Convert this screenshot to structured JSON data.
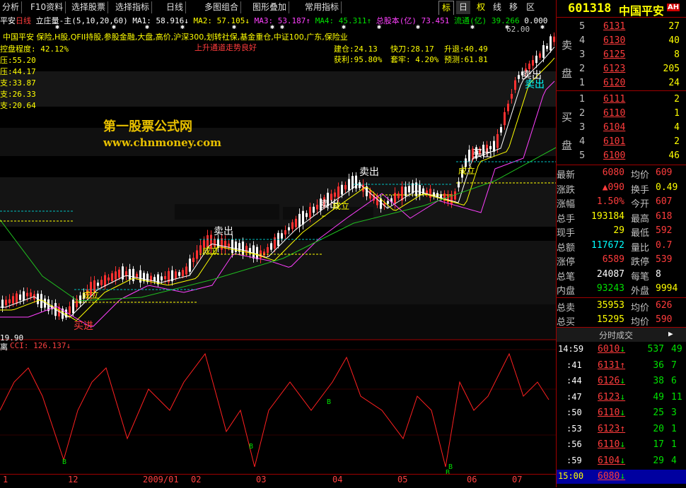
{
  "toolbar": {
    "items": [
      "分析",
      "F10资料",
      "选择股票",
      "选择指标",
      "日线",
      "多图组合",
      "图形叠加",
      "常用指标"
    ],
    "right_buttons": [
      "标",
      "日",
      "权",
      "线",
      "移",
      "区"
    ]
  },
  "stock_header": {
    "code": "601318",
    "name": "中国平安",
    "badge": "AH"
  },
  "chart_info": {
    "stock_short": "平安",
    "period": "日线",
    "formula": "立庄量-主",
    "params": "(5,10,20,60)",
    "ma1": "MA1: 58.916↓",
    "ma2": "MA2: 57.105↓",
    "ma3": "MA3: 53.187↑",
    "ma4": "MA4: 45.311↑",
    "total_cap": "总股本(亿) 73.451",
    "float_cap": "流通(亿) 39.266",
    "extra": "0.000",
    "concepts": "中国平安 保险,H股,QFII持股,参股金融,大盘,高价,沪深300,划转社保,基金重仓,中证100,广东,保险业",
    "trend_text": "上升通道走势良好",
    "control_degree": "控盘程度: 42.12%",
    "level1": "压:55.20",
    "level2": "压:44.17",
    "level3": "支:33.87",
    "level4": "支:26.33",
    "level5": "支:20.64",
    "jiancang": "建仓:24.13",
    "kuaidao": "快刀:28.17",
    "shengtui": "升退:40.49",
    "huoli": "获利:95.80%",
    "taolao": "套牢: 4.20%",
    "yuce": "预测:61.81",
    "top_price": "62.00",
    "low_label": "19.90",
    "watermark1": "第一股票公式网",
    "watermark2": "www.chnmoney.com",
    "signals": [
      "买进",
      "成立",
      "成立",
      "卖出",
      "卖出",
      "成立",
      "卖出",
      "成立",
      "买出",
      "卖出",
      "卖出"
    ]
  },
  "cci": {
    "label": "CCI: 126.137↓",
    "prefix": "离",
    "buy_marks": [
      "B",
      "B",
      "B",
      "B",
      "B"
    ]
  },
  "date_axis": [
    "1",
    "12",
    "2009/01",
    "02",
    "03",
    "04",
    "05",
    "06",
    "07"
  ],
  "quote": {
    "sell_label": "卖盘",
    "buy_label": "买盘",
    "asks": [
      {
        "lvl": "5",
        "price": "6131",
        "vol": "27"
      },
      {
        "lvl": "4",
        "price": "6130",
        "vol": "40"
      },
      {
        "lvl": "3",
        "price": "6125",
        "vol": "8"
      },
      {
        "lvl": "2",
        "price": "6123",
        "vol": "205"
      },
      {
        "lvl": "1",
        "price": "6120",
        "vol": "24"
      }
    ],
    "bids": [
      {
        "lvl": "1",
        "price": "6111",
        "vol": "2"
      },
      {
        "lvl": "2",
        "price": "6110",
        "vol": "1"
      },
      {
        "lvl": "3",
        "price": "6104",
        "vol": "4"
      },
      {
        "lvl": "4",
        "price": "6101",
        "vol": "2"
      },
      {
        "lvl": "5",
        "price": "6100",
        "vol": "46"
      }
    ],
    "stats": [
      {
        "k1": "最新",
        "v1": "6080",
        "k2": "均价",
        "v2": "609"
      },
      {
        "k1": "涨跌",
        "v1": "▲090",
        "k2": "换手",
        "v2": "0.49"
      },
      {
        "k1": "涨幅",
        "v1": "1.50%",
        "k2": "今开",
        "v2": "607"
      },
      {
        "k1": "总手",
        "v1": "193184",
        "k2": "最高",
        "v2": "618"
      },
      {
        "k1": "现手",
        "v1": "29",
        "k2": "最低",
        "v2": "592"
      },
      {
        "k1": "总额",
        "v1": "117672",
        "k2": "量比",
        "v2": "0.7"
      },
      {
        "k1": "涨停",
        "v1": "6589",
        "k2": "跌停",
        "v2": "539"
      },
      {
        "k1": "总笔",
        "v1": "24087",
        "k2": "每笔",
        "v2": "8"
      },
      {
        "k1": "内盘",
        "v1": "93243",
        "k2": "外盘",
        "v2": "9994"
      }
    ],
    "bottom": [
      {
        "k1": "总卖",
        "v1": "35953",
        "k2": "均价",
        "v2": "626"
      },
      {
        "k1": "总买",
        "v1": "15295",
        "k2": "均价",
        "v2": "590"
      }
    ],
    "ticks_title": "分时成交",
    "ticks": [
      {
        "t": "14:59",
        "p": "6010",
        "d": "down",
        "v": "537",
        "n": "49"
      },
      {
        "t": ":41",
        "p": "6131",
        "d": "up",
        "v": "36",
        "n": "7"
      },
      {
        "t": ":44",
        "p": "6126",
        "d": "down",
        "v": "38",
        "n": "6"
      },
      {
        "t": ":47",
        "p": "6123",
        "d": "down",
        "v": "49",
        "n": "11"
      },
      {
        "t": ":50",
        "p": "6110",
        "d": "down",
        "v": "25",
        "n": "3"
      },
      {
        "t": ":53",
        "p": "6123",
        "d": "up",
        "v": "20",
        "n": "1"
      },
      {
        "t": ":56",
        "p": "6110",
        "d": "down",
        "v": "17",
        "n": "1"
      },
      {
        "t": ":59",
        "p": "6104",
        "d": "down",
        "v": "29",
        "n": "4"
      },
      {
        "t": "15:00",
        "p": "6080",
        "d": "down",
        "v": "",
        "n": ""
      }
    ]
  }
}
